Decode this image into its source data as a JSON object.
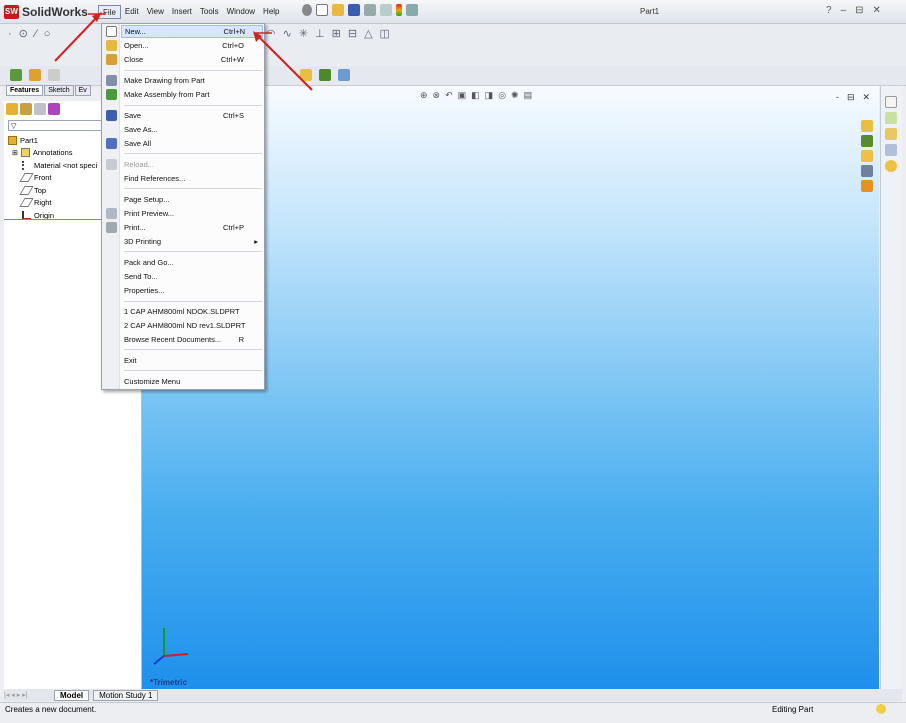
{
  "app": {
    "name": "SolidWorks",
    "logo_text": "SW",
    "document_title": "Part1"
  },
  "menubar": [
    "File",
    "Edit",
    "View",
    "Insert",
    "Tools",
    "Window",
    "Help"
  ],
  "window_controls": [
    "?",
    "-",
    "–",
    "⊟",
    "✕"
  ],
  "feature_manager": {
    "tabs": [
      "Features",
      "Sketch",
      "Ev"
    ],
    "tree": [
      {
        "label": "Part1",
        "icon": "part-icon"
      },
      {
        "label": "Annotations",
        "icon": "annotations-icon"
      },
      {
        "label": "Material <not speci",
        "icon": "material-icon"
      },
      {
        "label": "Front",
        "icon": "plane-icon"
      },
      {
        "label": "Top",
        "icon": "plane-icon"
      },
      {
        "label": "Right",
        "icon": "plane-icon"
      },
      {
        "label": "Origin",
        "icon": "origin-icon"
      }
    ]
  },
  "file_menu": {
    "items": [
      {
        "label": "New...",
        "shortcut": "Ctrl+N"
      },
      {
        "label": "Open...",
        "shortcut": "Ctrl+O"
      },
      {
        "label": "Close",
        "shortcut": "Ctrl+W"
      },
      {
        "label": "Make Drawing from Part",
        "shortcut": ""
      },
      {
        "label": "Make Assembly from Part",
        "shortcut": ""
      },
      {
        "label": "Save",
        "shortcut": "Ctrl+S"
      },
      {
        "label": "Save As...",
        "shortcut": ""
      },
      {
        "label": "Save All",
        "shortcut": ""
      },
      {
        "label": "Reload...",
        "shortcut": ""
      },
      {
        "label": "Find References...",
        "shortcut": ""
      },
      {
        "label": "Page Setup...",
        "shortcut": ""
      },
      {
        "label": "Print Preview...",
        "shortcut": ""
      },
      {
        "label": "Print...",
        "shortcut": "Ctrl+P"
      },
      {
        "label": "3D Printing",
        "shortcut": "▸"
      },
      {
        "label": "Pack and Go...",
        "shortcut": ""
      },
      {
        "label": "Send To...",
        "shortcut": ""
      },
      {
        "label": "Properties...",
        "shortcut": ""
      },
      {
        "label": "1 CAP AHM800ml NDOK.SLDPRT",
        "shortcut": ""
      },
      {
        "label": "2 CAP AHM800ml ND rev1.SLDPRT",
        "shortcut": ""
      },
      {
        "label": "Browse Recent Documents...",
        "shortcut": "R"
      },
      {
        "label": "Exit",
        "shortcut": ""
      },
      {
        "label": "Customize Menu",
        "shortcut": ""
      }
    ]
  },
  "viewport": {
    "view_label": "*Trimetric"
  },
  "bottom_tabs": [
    "Model",
    "Motion Study 1"
  ],
  "status": {
    "message": "Creates a new document.",
    "mode": "Editing Part"
  },
  "colors": {
    "annotation_arrow": "#d42020",
    "menu_highlight": "#d8e6fa",
    "viewport_bottom": "#1e90ec"
  }
}
